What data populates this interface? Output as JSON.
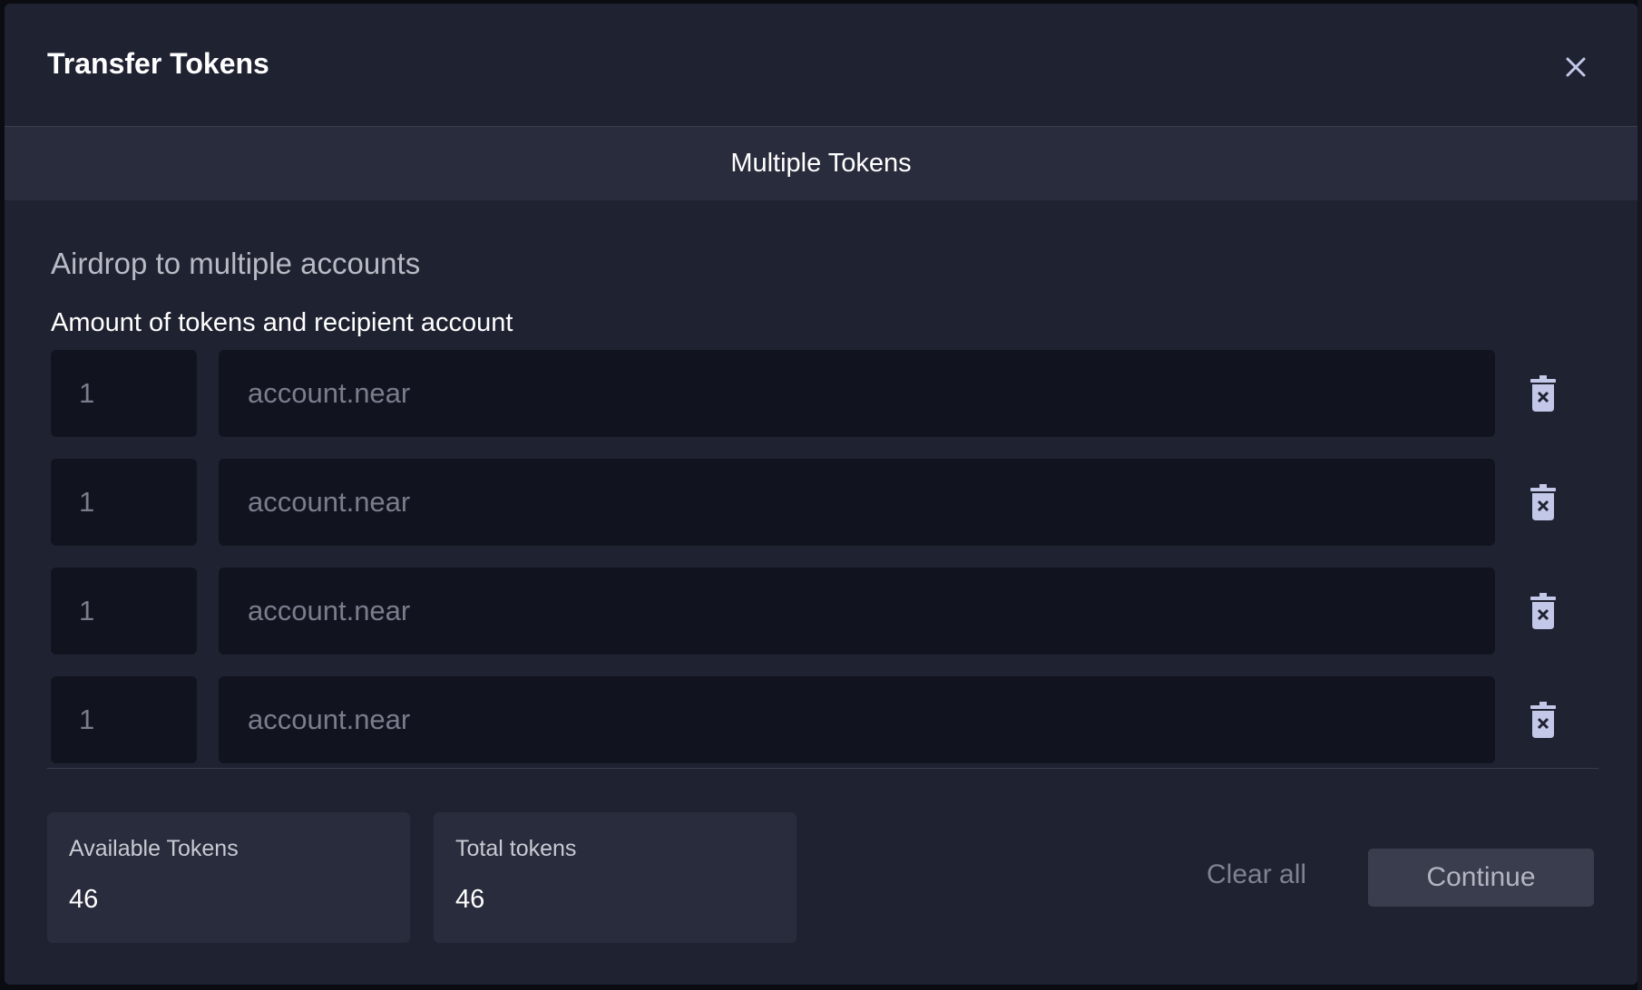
{
  "modal": {
    "title": "Transfer Tokens",
    "tab_label": "Multiple Tokens",
    "section_title": "Airdrop to multiple accounts",
    "field_label": "Amount of tokens and recipient account"
  },
  "rows": [
    {
      "amount": "1",
      "account_placeholder": "account.near"
    },
    {
      "amount": "1",
      "account_placeholder": "account.near"
    },
    {
      "amount": "1",
      "account_placeholder": "account.near"
    },
    {
      "amount": "1",
      "account_placeholder": "account.near"
    }
  ],
  "stats": {
    "available_label": "Available Tokens",
    "available_value": "46",
    "total_label": "Total tokens",
    "total_value": "46"
  },
  "actions": {
    "clear_all_label": "Clear all",
    "continue_label": "Continue"
  },
  "icons": {
    "close": "close-icon",
    "delete": "trash-icon"
  },
  "colors": {
    "modal_bg": "#1f2231",
    "input_bg": "#11131f",
    "card_bg": "#292c3c",
    "button_bg": "#3a3d4e"
  }
}
